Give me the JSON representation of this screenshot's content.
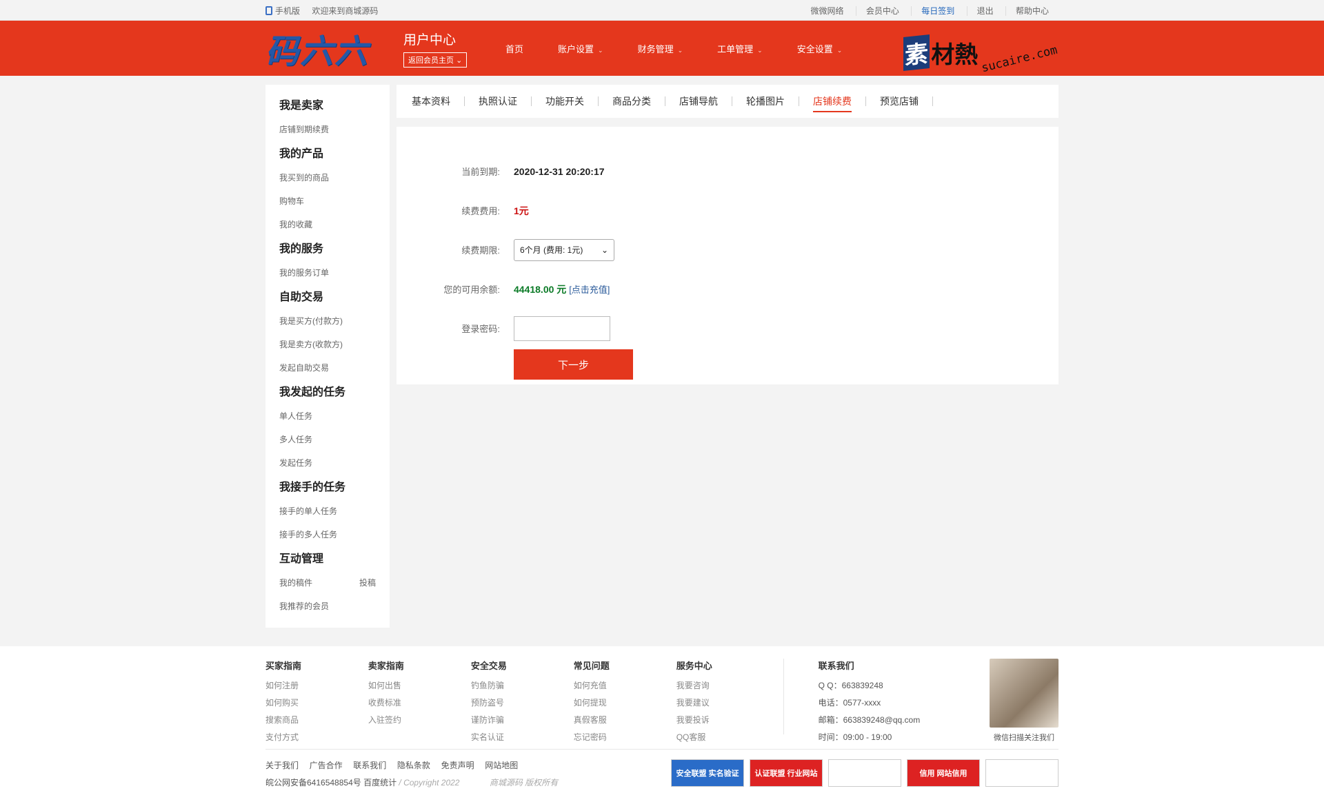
{
  "topbar": {
    "mobile": "手机版",
    "welcome": "欢迎来到商城源码",
    "links": [
      "微微网络",
      "会员中心",
      "每日签到",
      "退出",
      "帮助中心"
    ]
  },
  "header": {
    "logo": "码六六",
    "user_center": "用户中心",
    "back_home": "返回会员主页",
    "nav": [
      "首页",
      "账户设置",
      "财务管理",
      "工单管理",
      "安全设置"
    ],
    "watermark": {
      "su": "素",
      "cai": "材熱",
      "domain": "sucaire.com"
    }
  },
  "sidebar": {
    "groups": [
      {
        "title": "我是卖家",
        "items": [
          "店铺到期续费"
        ]
      },
      {
        "title": "我的产品",
        "items": [
          "我买到的商品",
          "购物车",
          "我的收藏"
        ]
      },
      {
        "title": "我的服务",
        "items": [
          "我的服务订单"
        ]
      },
      {
        "title": "自助交易",
        "items": [
          "我是买方(付款方)",
          "我是卖方(收款方)",
          "发起自助交易"
        ]
      },
      {
        "title": "我发起的任务",
        "items": [
          "单人任务",
          "多人任务",
          "发起任务"
        ]
      },
      {
        "title": "我接手的任务",
        "items": [
          "接手的单人任务",
          "接手的多人任务"
        ]
      },
      {
        "title": "互动管理",
        "items": [
          "我的稿件",
          "我推荐的会员"
        ]
      }
    ],
    "extra_link": "投稿"
  },
  "tabs": [
    "基本资料",
    "执照认证",
    "功能开关",
    "商品分类",
    "店铺导航",
    "轮播图片",
    "店铺续费",
    "预览店铺"
  ],
  "active_tab": "店铺续费",
  "form": {
    "expiry_label": "当前到期:",
    "expiry_value": "2020-12-31 20:20:17",
    "fee_label": "续费费用:",
    "fee_value": "1元",
    "period_label": "续费期限:",
    "period_value": "6个月 (费用: 1元)",
    "balance_label": "您的可用余额:",
    "balance_value": "44418.00 元",
    "recharge": "[点击充值]",
    "password_label": "登录密码:",
    "password_value": "",
    "submit": "下一步"
  },
  "footer": {
    "columns": [
      {
        "title": "买家指南",
        "links": [
          "如何注册",
          "如何购买",
          "搜索商品",
          "支付方式"
        ]
      },
      {
        "title": "卖家指南",
        "links": [
          "如何出售",
          "收费标准",
          "入驻签约"
        ]
      },
      {
        "title": "安全交易",
        "links": [
          "钓鱼防骗",
          "预防盗号",
          "谨防诈骗",
          "实名认证"
        ]
      },
      {
        "title": "常见问题",
        "links": [
          "如何充值",
          "如何提现",
          "真假客服",
          "忘记密码"
        ]
      },
      {
        "title": "服务中心",
        "links": [
          "我要咨询",
          "我要建议",
          "我要投诉",
          "QQ客服"
        ]
      }
    ],
    "contact": {
      "title": "联系我们",
      "lines": [
        "Q Q：663839248",
        "电话：0577-xxxx",
        "邮箱：663839248@qq.com",
        "时间：09:00 - 19:00"
      ]
    },
    "qr_caption": "微信扫描关注我们",
    "bottom_links": [
      "关于我们",
      "广告合作",
      "联系我们",
      "隐私条款",
      "免责声明",
      "网站地图"
    ],
    "icp": "皖公网安备6416548854号 百度统计",
    "copyright": "/ Copyright 2022",
    "rights": "商城源码 版权所有",
    "badges": [
      "安全联盟 实名验证",
      "认证联盟 行业网站",
      "",
      "信用 网站信用",
      ""
    ]
  },
  "colors": {
    "brand_red": "#e4371d",
    "logo_blue": "#2458a8",
    "balance_green": "#0a7a26"
  }
}
